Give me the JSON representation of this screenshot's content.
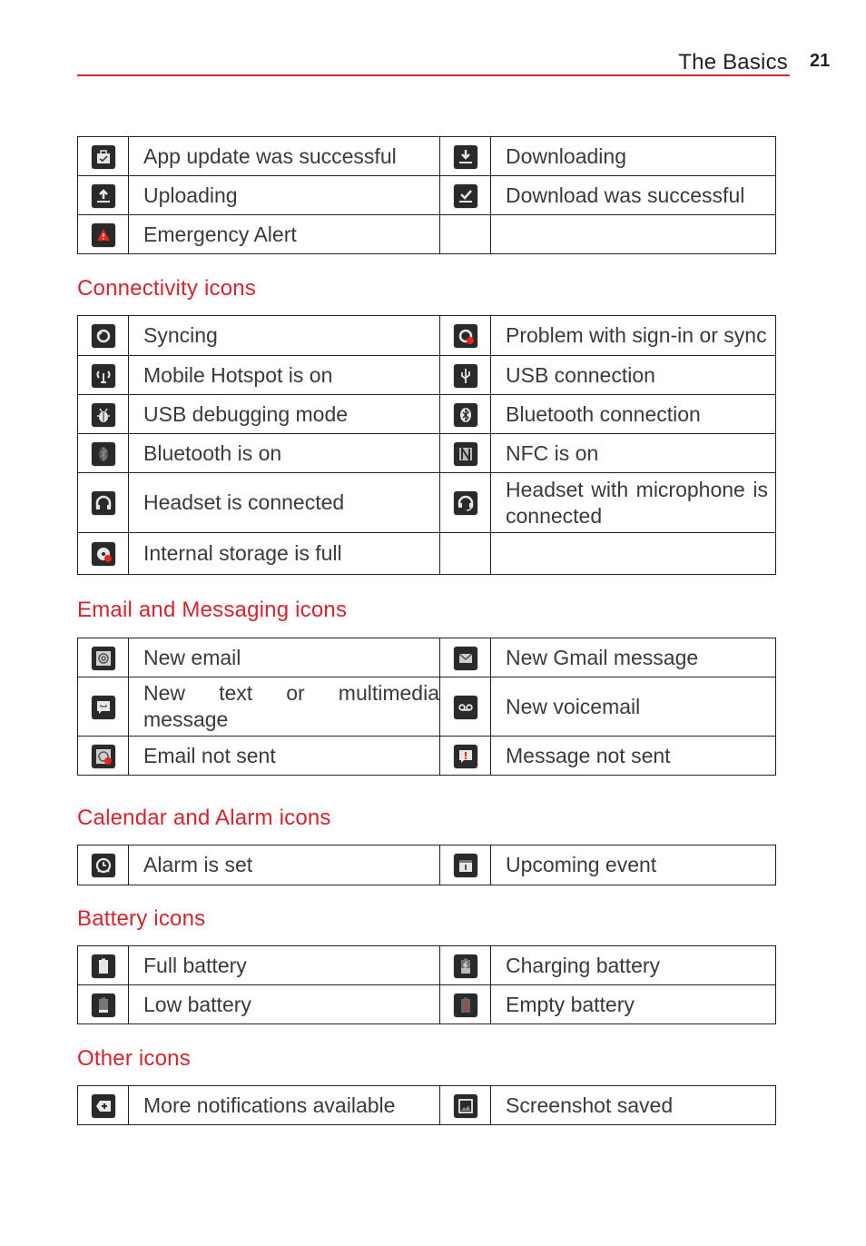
{
  "header": {
    "title": "The Basics",
    "page_number": "21"
  },
  "colors": {
    "accent": "#d3252f",
    "text": "#3a3a3a",
    "icon_bg": "#2a2a2a",
    "alert_red": "#e8231f"
  },
  "tables": {
    "notification": {
      "rows": [
        [
          {
            "icon": "app-update-icon",
            "label": "App update was successful"
          },
          {
            "icon": "download-icon",
            "label": "Downloading"
          }
        ],
        [
          {
            "icon": "upload-icon",
            "label": "Uploading"
          },
          {
            "icon": "download-success-icon",
            "label": "Download was successful"
          }
        ],
        [
          {
            "icon": "emergency-alert-icon",
            "label": "Emergency Alert"
          },
          {
            "icon": "",
            "label": ""
          }
        ]
      ]
    },
    "connectivity": {
      "title": "Connectivity icons",
      "rows": [
        [
          {
            "icon": "sync-icon",
            "label": "Syncing"
          },
          {
            "icon": "sync-problem-icon",
            "label": "Problem with sign-in or sync"
          }
        ],
        [
          {
            "icon": "hotspot-icon",
            "label": "Mobile Hotspot is on"
          },
          {
            "icon": "usb-icon",
            "label": "USB connection"
          }
        ],
        [
          {
            "icon": "usb-debug-icon",
            "label": "USB debugging mode"
          },
          {
            "icon": "bluetooth-connected-icon",
            "label": "Bluetooth connection"
          }
        ],
        [
          {
            "icon": "bluetooth-on-icon",
            "label": "Bluetooth is on"
          },
          {
            "icon": "nfc-icon",
            "label": "NFC is on"
          }
        ],
        [
          {
            "icon": "headset-icon",
            "label": "Headset is connected"
          },
          {
            "icon": "headset-mic-icon",
            "label": "Headset with microphone is connected"
          }
        ],
        [
          {
            "icon": "storage-full-icon",
            "label": "Internal storage is full"
          },
          {
            "icon": "",
            "label": ""
          }
        ]
      ]
    },
    "messaging": {
      "title": "Email and Messaging icons",
      "rows": [
        [
          {
            "icon": "email-icon",
            "label": "New email"
          },
          {
            "icon": "gmail-icon",
            "label": "New Gmail message"
          }
        ],
        [
          {
            "icon": "sms-icon",
            "label": "New text or multimedia message"
          },
          {
            "icon": "voicemail-icon",
            "label": "New voicemail"
          }
        ],
        [
          {
            "icon": "email-error-icon",
            "label": "Email not sent"
          },
          {
            "icon": "message-error-icon",
            "label": "Message not sent"
          }
        ]
      ]
    },
    "calendar": {
      "title": "Calendar and Alarm icons",
      "rows": [
        [
          {
            "icon": "alarm-icon",
            "label": "Alarm is set"
          },
          {
            "icon": "calendar-icon",
            "label": "Upcoming event"
          }
        ]
      ]
    },
    "battery": {
      "title": "Battery icons",
      "rows": [
        [
          {
            "icon": "battery-full-icon",
            "label": "Full battery"
          },
          {
            "icon": "battery-charging-icon",
            "label": "Charging battery"
          }
        ],
        [
          {
            "icon": "battery-low-icon",
            "label": "Low battery"
          },
          {
            "icon": "battery-empty-icon",
            "label": "Empty battery"
          }
        ]
      ]
    },
    "other": {
      "title": "Other icons",
      "rows": [
        [
          {
            "icon": "more-notifications-icon",
            "label": "More notifications available"
          },
          {
            "icon": "screenshot-icon",
            "label": "Screenshot saved"
          }
        ]
      ]
    }
  }
}
